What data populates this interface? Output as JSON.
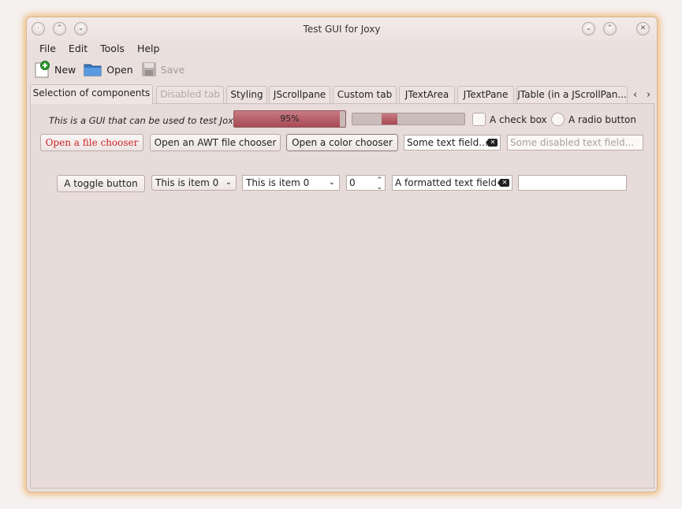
{
  "window": {
    "title": "Test GUI for Joxy",
    "title_buttons_left": [
      "·",
      "⌃",
      "⌄"
    ],
    "title_buttons_right": [
      "⌄",
      "⌃",
      "✕"
    ]
  },
  "menu": [
    "File",
    "Edit",
    "Tools",
    "Help"
  ],
  "toolbar": {
    "new_label": "New",
    "open_label": "Open",
    "save_label": "Save"
  },
  "tabs": [
    {
      "label": "Selection of components",
      "state": "active"
    },
    {
      "label": "Disabled tab",
      "state": "disabled"
    },
    {
      "label": "Styling",
      "state": "normal"
    },
    {
      "label": "JScrollpane",
      "state": "normal"
    },
    {
      "label": "Custom tab",
      "state": "normal"
    },
    {
      "label": "JTextArea",
      "state": "normal"
    },
    {
      "label": "JTextPane",
      "state": "normal"
    },
    {
      "label": "JTable (in a JScrollPan...",
      "state": "normal"
    }
  ],
  "row1": {
    "intro_text": "This is a GUI that can be used to test Joxy.",
    "progress_text": "95%",
    "progress_value": 0.95,
    "checkbox_label": "A check box",
    "radio_label": "A radio button"
  },
  "row2": {
    "file_chooser_label": "Open a file chooser",
    "awt_chooser_label": "Open an AWT file chooser",
    "color_chooser_label": "Open a color chooser",
    "text_field_value": "Some text field...",
    "disabled_field_placeholder": "Some disabled text field..."
  },
  "row3": {
    "toggle_label": "A toggle button",
    "combo1_value": "This is item 0",
    "combo2_value": "This is item 0",
    "spinner_value": "0",
    "formatted_field_value": "A formatted text field",
    "empty_field_value": ""
  },
  "colors": {
    "accent_red": "#b84a55",
    "progress_fill": "#b85c66",
    "window_glow": "#f0b46e"
  }
}
